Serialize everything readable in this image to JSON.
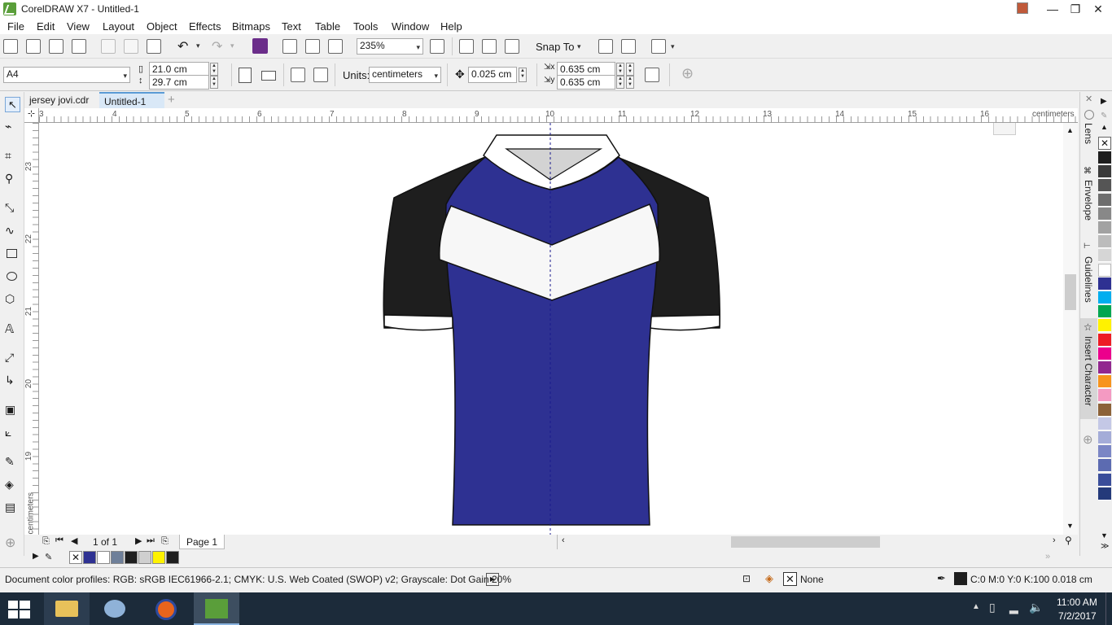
{
  "window": {
    "title": "CorelDRAW X7 - Untitled-1",
    "minimize": "—",
    "restore": "❐",
    "close": "✕"
  },
  "menu": [
    "File",
    "Edit",
    "View",
    "Layout",
    "Object",
    "Effects",
    "Bitmaps",
    "Text",
    "Table",
    "Tools",
    "Window",
    "Help"
  ],
  "toolbar": {
    "zoom": "235%",
    "snap_to": "Snap To",
    "icons": [
      "new-icon",
      "open-icon",
      "save-icon",
      "print-icon",
      "cut-icon",
      "copy-icon",
      "paste-icon",
      "undo-icon",
      "redo-icon",
      "corel-connect-icon",
      "import-icon",
      "export-icon",
      "publish-pdf-icon",
      "zoom-fit-icon",
      "rulers-icon",
      "view-icon",
      "grid-icon",
      "welcome-icon",
      "options-icon",
      "launch-icon"
    ]
  },
  "propertybar": {
    "page_size": "A4",
    "width": "21.0 cm",
    "height": "29.7 cm",
    "units_label": "Units:",
    "units": "centimeters",
    "nudge": "0.025 cm",
    "dup_x": "0.635 cm",
    "dup_y": "0.635 cm"
  },
  "tabs": [
    "jersey jovi.cdr",
    "Untitled-1"
  ],
  "active_tab": "Untitled-1",
  "ruler": {
    "unit": "centimeters",
    "h_ticks": [
      "3",
      "4",
      "5",
      "6",
      "7",
      "8",
      "9",
      "10",
      "11",
      "12",
      "13",
      "14",
      "15",
      "16"
    ],
    "v_ticks": [
      "23",
      "22",
      "21",
      "20",
      "19"
    ],
    "v_unit": "centimeters"
  },
  "dockers": [
    "Lens",
    "Envelope",
    "Guidelines",
    "Insert Character"
  ],
  "palette_colors": [
    "#1e1e1e",
    "#3a3a3a",
    "#555555",
    "#6e6e6e",
    "#888888",
    "#a2a2a2",
    "#bcbcbc",
    "#d6d6d6",
    "#ffffff",
    "#2e3192",
    "#00aeef",
    "#00a651",
    "#fff200",
    "#ed1c24",
    "#ec008c",
    "#92278f",
    "#f7941d",
    "#f49ac2",
    "#8c6239",
    "#c4c8e6",
    "#a4acd8",
    "#7b86c5",
    "#5c6bb1",
    "#3a4d9a",
    "#243a7a"
  ],
  "pagenav": {
    "counter": "1 of 1",
    "page_tab": "Page 1"
  },
  "doc_palette": [
    "#2e3192",
    "#ffffff",
    "#6e7f99",
    "#1e1e1e",
    "#cfcfcf",
    "#fff200",
    "#1e1e1e"
  ],
  "status": {
    "color_profiles": "Document color profiles: RGB: sRGB IEC61966-2.1; CMYK: U.S. Web Coated (SWOP) v2; Grayscale: Dot Gain 20%",
    "fill": "None",
    "outline": "C:0 M:0 Y:0 K:100  0.018 cm"
  },
  "taskbar": {
    "time": "11:00 AM",
    "date": "7/2/2017"
  },
  "jersey_colors": {
    "body": "#2e3192",
    "sleeve": "#1e1e1e",
    "chevron": "#f7f7f7",
    "collar": "#ffffff",
    "neck_inner": "#d3d3d3"
  }
}
